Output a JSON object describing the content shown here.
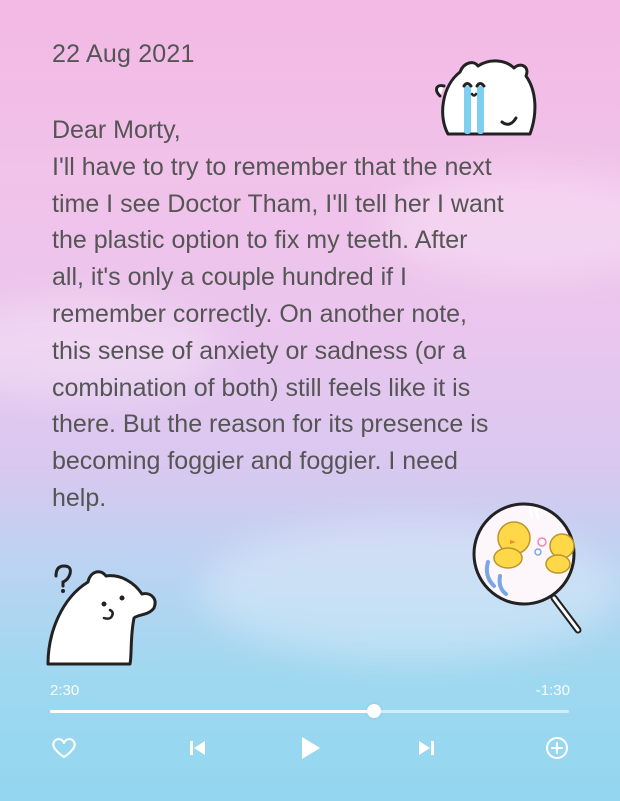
{
  "note": {
    "date": "22 Aug 2021",
    "lines": [
      "Dear Morty,",
      "I'll have to try to remember that the next",
      "time I see Doctor Tham, I'll tell her I want",
      "the plastic option to fix my teeth. After",
      "all,  it's only a couple hundred if I",
      "remember correctly. On another note,",
      "this sense of anxiety or sadness (or a",
      "combination of both) still feels like it is",
      "there. But the reason for its presence is",
      "becoming foggier and foggier. I need",
      "help."
    ]
  },
  "player": {
    "elapsed": "2:30",
    "remaining": "-1:30",
    "progress": 0.625
  },
  "icons": {
    "like": "heart-icon",
    "previous": "skip-back-icon",
    "play": "play-icon",
    "next": "skip-forward-icon",
    "add": "plus-circle-icon"
  },
  "colors": {
    "text": "#555555",
    "gradient_top": "#f2b9e4",
    "gradient_bottom": "#93d6ef",
    "control": "#ffffff"
  }
}
